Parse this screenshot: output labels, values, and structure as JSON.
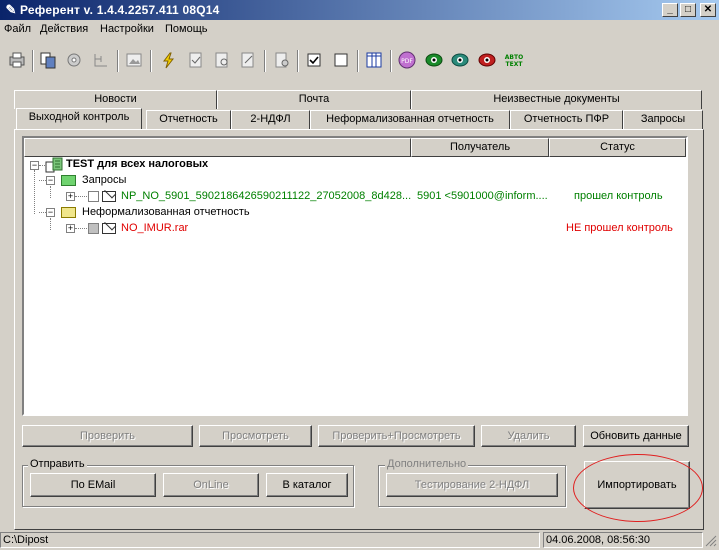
{
  "window": {
    "title": "Референт v. 1.4.4.2257.411 08Q14",
    "minimize": "_",
    "maximize": "□",
    "close": "✕"
  },
  "menu": [
    "Файл",
    "Действия",
    "Настройки",
    "Помощь"
  ],
  "tabs_row1": [
    "Новости",
    "Почта",
    "Неизвестные документы"
  ],
  "tabs_row2": [
    "Выходной контроль",
    "Отчетность",
    "2-НДФЛ",
    "Неформализованная отчетность",
    "Отчетность ПФР",
    "Запросы"
  ],
  "active_tab": "Выходной контроль",
  "toolbar_icons": [
    "print-icon",
    "copy-icon",
    "settings-icon",
    "tree-icon",
    "image-icon",
    "sign-icon",
    "doc-check-icon",
    "doc-search-icon",
    "doc-edit-icon",
    "doc-export-icon",
    "checkbox-checked-icon",
    "checkbox-empty-icon",
    "columns-icon",
    "pdf-icon",
    "eye-green-icon",
    "eye-teal-icon",
    "eye-red-icon",
    "auto-text-icon"
  ],
  "toolbar_text": {
    "pdf": "PDF",
    "auto": "АВТО\nTEXT"
  },
  "columns": {
    "recipient": "Получатель",
    "status": "Статус"
  },
  "tree": {
    "root": "TEST для всех налоговых",
    "group1": "Запросы",
    "item1": {
      "name": "NP_NO_5901_5902186426590211122_27052008_8d428...",
      "recipient": "5901 <5901000@inform....",
      "status": "прошел контроль"
    },
    "group2": "Неформализованная отчетность",
    "item2": {
      "name": "NO_IMUR.rar",
      "status": "НЕ прошел контроль"
    }
  },
  "buttons": {
    "check": "Проверить",
    "view": "Просмотреть",
    "check_view": "Проверить+Просмотреть",
    "delete": "Удалить",
    "refresh": "Обновить данные"
  },
  "send_group": {
    "label": "Отправить",
    "email": "По EMail",
    "online": "OnLine",
    "catalog": "В каталог"
  },
  "extra_group": {
    "label": "Дополнительно",
    "test": "Тестирование 2-НДФЛ"
  },
  "import_button": "Импортировать",
  "status": {
    "path": "C:\\Dipost",
    "datetime": "04.06.2008, 08:56:30"
  },
  "colors": {
    "ok": "#008000",
    "fail": "#e00000",
    "highlight": "#e02020"
  }
}
